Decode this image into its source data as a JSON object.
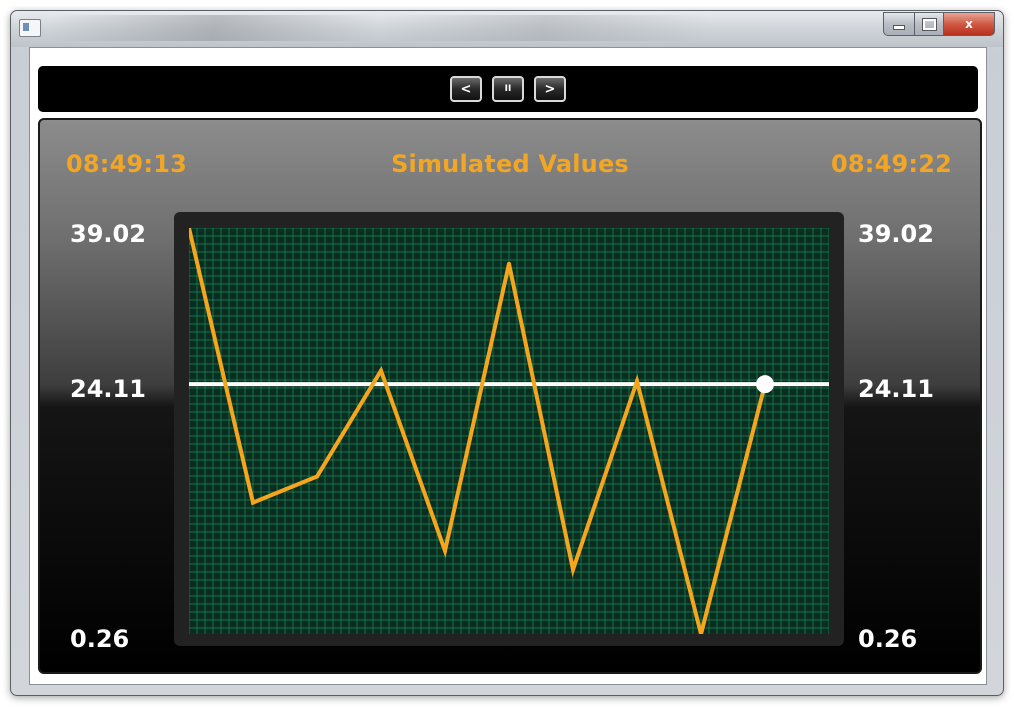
{
  "window": {
    "controls": {
      "minimize": "minimize",
      "maximize": "maximize",
      "close": "x"
    }
  },
  "toolbar": {
    "prev_label": "<",
    "pause_label": "II",
    "next_label": ">"
  },
  "header": {
    "time_start": "08:49:13",
    "title": "Simulated Values",
    "time_end": "08:49:22"
  },
  "axis": {
    "left": {
      "max": "39.02",
      "mid": "24.11",
      "min": "0.26"
    },
    "right": {
      "max": "39.02",
      "mid": "24.11",
      "min": "0.26"
    }
  },
  "colors": {
    "accent": "#f2a623",
    "grid": "#1fa863",
    "plot_bg": "#0b2e23",
    "line": "#f5a61c",
    "reference_line": "#ffffff"
  },
  "chart_data": {
    "type": "line",
    "title": "Simulated Values",
    "x_range": [
      "08:49:13",
      "08:49:22"
    ],
    "x": [
      0,
      1,
      2,
      3,
      4,
      5,
      6,
      7,
      8,
      9
    ],
    "series": [
      {
        "values": [
          39.02,
          12.8,
          15.3,
          25.4,
          8.2,
          35.6,
          6.4,
          24.4,
          0.26,
          24.11
        ]
      }
    ],
    "reference_line": 24.11,
    "ylim": [
      0.26,
      39.02
    ],
    "y_ticks": [
      "39.02",
      "24.11",
      "0.26"
    ],
    "grid": true
  }
}
